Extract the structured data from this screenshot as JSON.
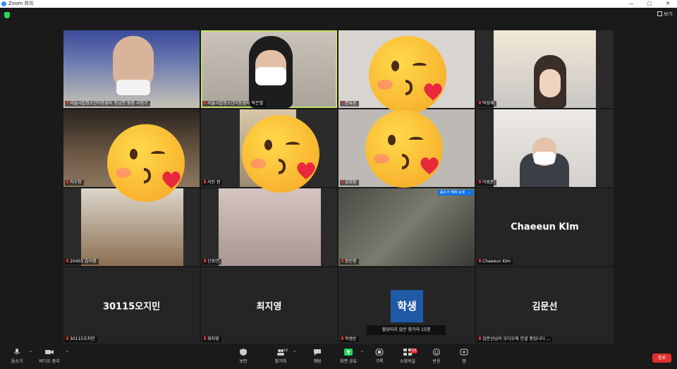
{
  "window": {
    "title": "Zoom 회의",
    "controls": [
      "—",
      "▢",
      "✕"
    ]
  },
  "top": {
    "view_label": "보기"
  },
  "tiles": [
    {
      "name": "서울시립청소년이동쉼터 동남권 팀장 서정기"
    },
    {
      "name": "서울시립청소년이동쉼터 락은별"
    },
    {
      "name": "문유흔"
    },
    {
      "name": "박성혜"
    },
    {
      "name": "허수정"
    },
    {
      "name": "서진 현"
    },
    {
      "name": "김희원"
    },
    {
      "name": "이범준"
    },
    {
      "name": "20403 김서영"
    },
    {
      "name": "신희연"
    },
    {
      "name": "장인봉",
      "speaker_label": "음소거 해제 요청",
      "more": "..."
    },
    {
      "name": "Chaeeun KIm",
      "display_name": "Chaeeun KIm"
    },
    {
      "name": "30115오지민",
      "display_name": "30115오지민"
    },
    {
      "name": "최지영",
      "display_name": "최지영"
    },
    {
      "name": "학생순",
      "avatar_text": "학생",
      "tooltip": "할당되지 않은 참가자 15명"
    },
    {
      "name": "김문선님이 오디오에 연결 중입니다 ...",
      "display_name": "김문선"
    }
  ],
  "toolbar": {
    "mute": "음소거",
    "video": "비디오 중지",
    "security": "보안",
    "participants": "참가자",
    "participants_count": "16",
    "chat": "채팅",
    "share": "화면 공유",
    "record": "기록",
    "breakout": "소회의실",
    "breakout_badge": "15",
    "reactions": "반응",
    "apps": "앱",
    "end": "종료"
  },
  "colors": {
    "accent": "#2d8cff",
    "active_border": "#c5e26a",
    "end": "#e0312e",
    "avatar": "#1f5aa6"
  }
}
